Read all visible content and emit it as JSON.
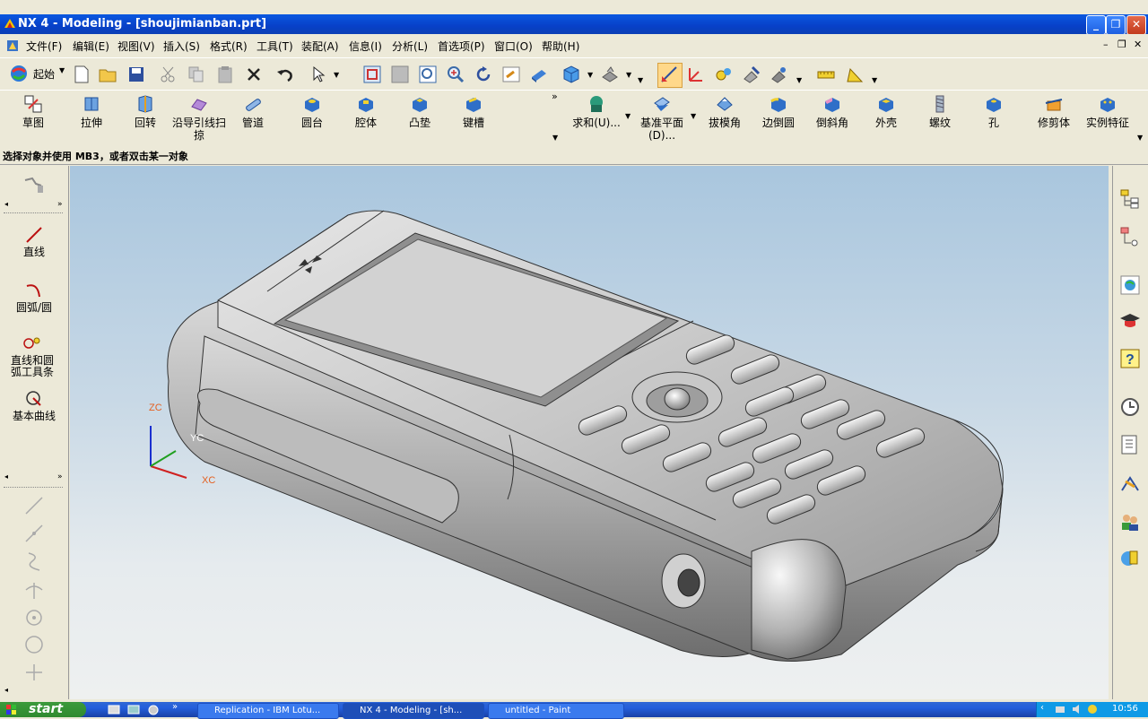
{
  "window": {
    "title": "NX 4 - Modeling - [shoujimianban.prt]"
  },
  "menu": {
    "file": "文件(F)",
    "edit": "编辑(E)",
    "view": "视图(V)",
    "insert": "插入(S)",
    "format": "格式(R)",
    "tools": "工具(T)",
    "assembly": "装配(A)",
    "info": "信息(I)",
    "analysis": "分析(L)",
    "prefs": "首选项(P)",
    "window": "窗口(O)",
    "help": "帮助(H)"
  },
  "toolbar": {
    "start_label": "起始"
  },
  "features": {
    "sketch": "草图",
    "extrude": "拉伸",
    "revolve": "回转",
    "sweep": "沿导引线扫掠",
    "tube": "管道",
    "boss": "圆台",
    "pocket": "腔体",
    "pad": "凸垫",
    "slot": "键槽",
    "unite": "求和(U)...",
    "datum_plane": "基准平面(D)...",
    "draft": "拔模角",
    "edge_blend": "边倒圆",
    "chamfer": "倒斜角",
    "shell": "外壳",
    "thread": "螺纹",
    "hole": "孔",
    "trim_body": "修剪体",
    "instance": "实例特征"
  },
  "status": {
    "prompt": "选择对象并使用 MB3，或者双击某一对象"
  },
  "palette": {
    "line": "直线",
    "arc": "圆弧/圆",
    "line_arc": "直线和圆弧工具条",
    "basic_curves": "基本曲线"
  },
  "axes": {
    "z": "ZC",
    "y": "YC",
    "x": "XC"
  },
  "taskbar": {
    "start": "start",
    "tasks": [
      "Replication - IBM Lotu...",
      "NX 4 - Modeling - [sh...",
      "untitled - Paint"
    ],
    "clock": "10:56"
  }
}
